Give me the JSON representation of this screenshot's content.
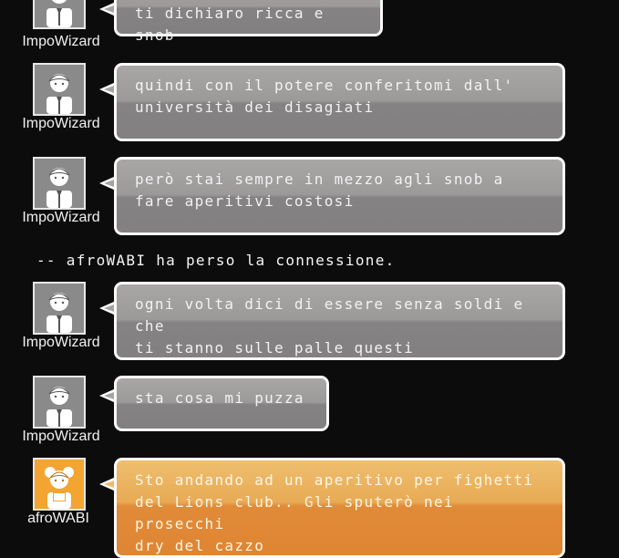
{
  "messages": [
    {
      "user": "ImpoWizard",
      "text_lines": [
        "ti dichiaro ricca e snob"
      ],
      "style": "gray"
    },
    {
      "user": "ImpoWizard",
      "text_lines": [
        "quindi con il potere conferitomi dall'",
        "università dei disagiati"
      ],
      "style": "gray"
    },
    {
      "user": "ImpoWizard",
      "text_lines": [
        "però stai sempre in mezzo agli snob a",
        "fare aperitivi costosi"
      ],
      "style": "gray"
    },
    {
      "user": "ImpoWizard",
      "text_lines": [
        "ogni volta dici di essere senza soldi e che",
        "ti stanno sulle palle questi"
      ],
      "style": "gray"
    },
    {
      "user": "ImpoWizard",
      "text_lines": [
        "sta cosa mi puzza"
      ],
      "style": "gray"
    },
    {
      "user": "afroWABI",
      "text_lines": [
        "Sto andando ad un aperitivo per fighetti",
        "del Lions club.. Gli sputerò nei prosecchi",
        "dry del cazzo"
      ],
      "style": "orange"
    }
  ],
  "system_message": "-- afroWABI ha perso la connessione.",
  "colors": {
    "background": "#0c0c0c",
    "bubble_gray": "#9a9797",
    "bubble_orange": "#e59a45",
    "avatar_orange": "#f3a431"
  },
  "icons": {
    "gray_avatar": "user-avatar-icon",
    "orange_avatar": "user-avatar-female-icon"
  }
}
